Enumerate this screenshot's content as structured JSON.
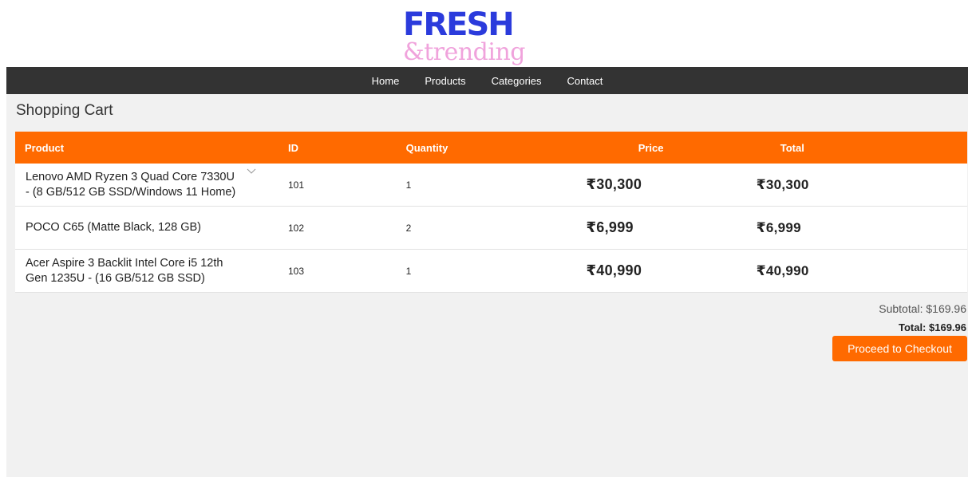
{
  "logo": {
    "line1": "FRESH",
    "line2": "&trending",
    "line1_color": "#2b3bdc",
    "line2_color": "#f0a3dc"
  },
  "nav": {
    "background": "#333333",
    "items": [
      {
        "label": "Home"
      },
      {
        "label": "Products"
      },
      {
        "label": "Categories"
      },
      {
        "label": "Contact"
      }
    ]
  },
  "cart": {
    "title": "Shopping Cart",
    "accent_color": "#ff6a00",
    "headers": {
      "product": "Product",
      "id": "ID",
      "quantity": "Quantity",
      "price": "Price",
      "total": "Total"
    },
    "rows": [
      {
        "product": "Lenovo AMD Ryzen 3 Quad Core 7330U - (8 GB/512 GB SSD/Windows 11 Home)",
        "id": "101",
        "quantity": "1",
        "price": "₹30,300",
        "total": "₹30,300"
      },
      {
        "product": "POCO C65 (Matte Black, 128 GB)",
        "id": "102",
        "quantity": "2",
        "price": "₹6,999",
        "total": "₹6,999"
      },
      {
        "product": "Acer Aspire 3 Backlit Intel Core i5 12th Gen 1235U - (16 GB/512 GB SSD)",
        "id": "103",
        "quantity": "1",
        "price": "₹40,990",
        "total": "₹40,990"
      }
    ],
    "subtotal_label": "Subtotal: $169.96",
    "total_label": "Total: $169.96",
    "checkout_label": "Proceed to Checkout"
  },
  "icons": {
    "row_expand": "chevron-down-icon"
  }
}
